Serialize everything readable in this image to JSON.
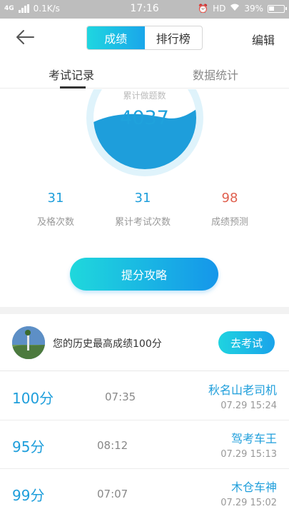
{
  "status_bar": {
    "network": "4G",
    "speed": "0.1K/s",
    "time": "17:16",
    "hd": "HD",
    "battery": "39%"
  },
  "header": {
    "tabs": [
      {
        "label": "成绩",
        "active": true
      },
      {
        "label": "排行榜",
        "active": false
      }
    ],
    "edit_label": "编辑"
  },
  "subtabs": [
    {
      "label": "考试记录",
      "active": true
    },
    {
      "label": "数据统计",
      "active": false
    }
  ],
  "gauge": {
    "label": "累计做题数",
    "value": "4037"
  },
  "stats": [
    {
      "value": "31",
      "label": "及格次数",
      "color": "#1e9edb"
    },
    {
      "value": "31",
      "label": "累计考试次数",
      "color": "#1e9edb"
    },
    {
      "value": "98",
      "label": "成绩预测",
      "color": "#e0604f"
    }
  ],
  "strategy_button": "提分攻略",
  "best": {
    "text": "您的历史最高成绩100分",
    "button": "去考试"
  },
  "records": [
    {
      "score": "100分",
      "duration": "07:35",
      "title": "秋名山老司机",
      "time": "07.29  15:24"
    },
    {
      "score": "95分",
      "duration": "08:12",
      "title": "驾考车王",
      "time": "07.29  15:13"
    },
    {
      "score": "99分",
      "duration": "07:07",
      "title": "木仓车神",
      "time": "07.29  15:02"
    }
  ],
  "colors": {
    "accent": "#1e9edb",
    "accent_gradient_start": "#1fd8dc",
    "accent_gradient_end": "#1596ea",
    "prediction": "#e0604f"
  }
}
